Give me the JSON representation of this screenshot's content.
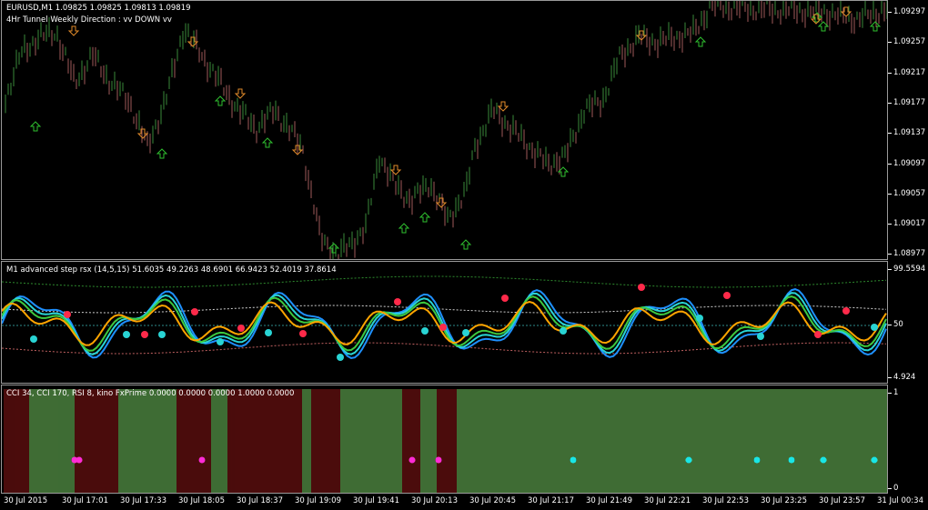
{
  "window": {
    "symbol_line": "EURUSD,M1  1.09825 1.09825 1.09813 1.09819",
    "indicator_line": "4Hr Tunnel Weekly Direction : vv DOWN vv"
  },
  "main_axis": [
    "1.09297",
    "1.09257",
    "1.09217",
    "1.09177",
    "1.09137",
    "1.09097",
    "1.09057",
    "1.09017",
    "1.08977"
  ],
  "rsx": {
    "title": "M1 advanced step rsx (14,5,15) 51.6035 49.2263 48.6901 66.9423 52.4019 37.8614",
    "axis": [
      "99.5594",
      "50",
      "4.924"
    ]
  },
  "cci": {
    "title": "CCI 34, CCI 170, RSI 8,  kino FxPrime  0.0000 0.0000 0.0000 1.0000 0.0000",
    "axis": [
      "1",
      "0"
    ]
  },
  "time_axis": [
    "30 Jul 2015",
    "30 Jul 17:01",
    "30 Jul 17:33",
    "30 Jul 18:05",
    "30 Jul 18:37",
    "30 Jul 19:09",
    "30 Jul 19:41",
    "30 Jul 20:13",
    "30 Jul 20:45",
    "30 Jul 21:17",
    "30 Jul 21:49",
    "30 Jul 22:21",
    "30 Jul 22:53",
    "30 Jul 23:25",
    "30 Jul 23:57",
    "31 Jul 00:34"
  ],
  "colors": {
    "bull": "#3a8a3a",
    "bear": "#a05a5a",
    "up_arrow": "#2fbf2f",
    "down_arrow": "#e08a2a",
    "rsx_cyan": "#1e90ff",
    "rsx_teal": "#29d4d4",
    "rsx_green": "#3ec93e",
    "rsx_orange": "#ffa500",
    "cci_green": "#8fd07a",
    "cci_red": "#8b1a1a",
    "dot_magenta": "#ff2bd6",
    "dot_cyan": "#19e6e6"
  },
  "icons": {
    "up": "up-arrow-icon",
    "down": "down-arrow-icon"
  }
}
